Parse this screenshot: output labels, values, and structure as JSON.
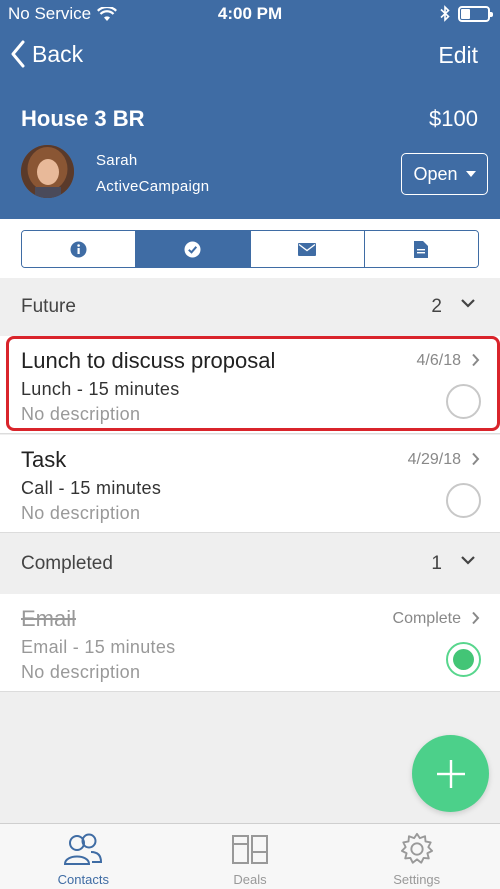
{
  "status_bar": {
    "carrier": "No Service",
    "time": "4:00 PM"
  },
  "nav": {
    "back_label": "Back",
    "edit_label": "Edit"
  },
  "deal": {
    "title": "House 3 BR",
    "value": "$100",
    "status": "Open"
  },
  "contact": {
    "name": "Sarah",
    "organization": "ActiveCampaign"
  },
  "segments": [
    {
      "icon": "info-icon",
      "active": false
    },
    {
      "icon": "check-circle-icon",
      "active": true
    },
    {
      "icon": "envelope-icon",
      "active": false
    },
    {
      "icon": "document-icon",
      "active": false
    }
  ],
  "sections": {
    "future": {
      "label": "Future",
      "count": "2"
    },
    "completed": {
      "label": "Completed",
      "count": "1"
    }
  },
  "tasks": {
    "lunch": {
      "title": "Lunch to discuss proposal",
      "date": "4/6/18",
      "type": "Lunch - 15 minutes",
      "description": "No description",
      "done": false
    },
    "task": {
      "title": "Task",
      "date": "4/29/18",
      "type": "Call - 15 minutes",
      "description": "No description",
      "done": false
    },
    "email": {
      "title": "Email",
      "date": "Complete",
      "type": "Email - 15 minutes",
      "description": "No description",
      "done": true
    }
  },
  "tabbar": {
    "contacts": "Contacts",
    "deals": "Deals",
    "settings": "Settings"
  },
  "colors": {
    "primary": "#3f6ca4",
    "accent": "#4cd08a",
    "highlight": "#d9242b"
  }
}
